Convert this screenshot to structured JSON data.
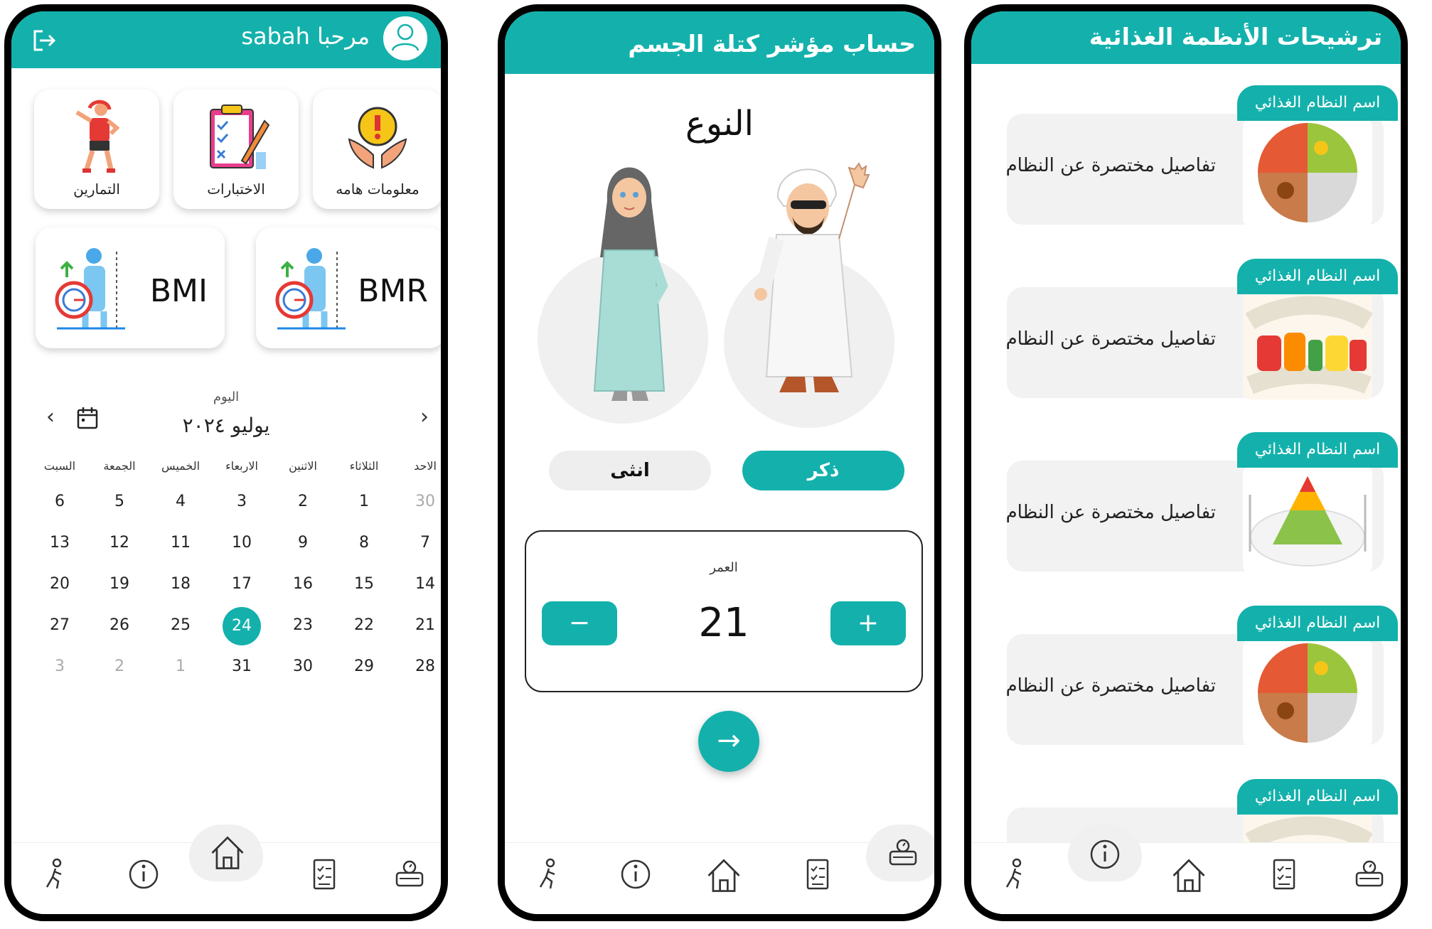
{
  "screen1": {
    "greeting": "مرحبا",
    "user_name": "sabah",
    "cards": [
      {
        "label": "معلومات هامه",
        "icon": "warning-hands-icon"
      },
      {
        "label": "الاختبارات",
        "icon": "checklist-icon"
      },
      {
        "label": "التمارين",
        "icon": "exercise-icon"
      }
    ],
    "bmi_cards": [
      "BMR",
      "BMI"
    ],
    "calendar": {
      "today_label": "اليوم",
      "month_label": "يوليو ٢٠٢٤",
      "weekdays": [
        "الاحد",
        "الثلاثاء",
        "الاثنين",
        "الاربعاء",
        "الخميس",
        "الجمعة",
        "السبت"
      ],
      "weeks": [
        [
          "30",
          "1",
          "2",
          "3",
          "4",
          "5",
          "6"
        ],
        [
          "7",
          "8",
          "9",
          "10",
          "11",
          "12",
          "13"
        ],
        [
          "14",
          "15",
          "16",
          "17",
          "18",
          "19",
          "20"
        ],
        [
          "21",
          "22",
          "23",
          "24",
          "25",
          "26",
          "27"
        ],
        [
          "28",
          "29",
          "30",
          "31",
          "1",
          "2",
          "3"
        ]
      ],
      "selected_day": "24"
    }
  },
  "screen2": {
    "title": "حساب مؤشر كتلة الجسم",
    "gender_title": "النوع",
    "male_label": "ذكر",
    "female_label": "انثى",
    "age_label": "العمر",
    "age_value": "21",
    "minus_label": "−",
    "plus_label": "+",
    "next_arrow": "→"
  },
  "screen3": {
    "title": "ترشيحات الأنظمة الغذائية",
    "diet_tab": "اسم النظام الغذائي",
    "diet_desc": "تفاصيل مختصرة عن النظام",
    "diets": [
      {
        "image": "food-plate-image"
      },
      {
        "image": "diet-tape-image"
      },
      {
        "image": "food-pyramid-image"
      },
      {
        "image": "food-plate-image"
      },
      {
        "image": "diet-tape-image"
      }
    ]
  },
  "colors": {
    "accent": "#14b1ac",
    "card_bg": "#f2f2f2",
    "nav_bump": "#f0f0f0"
  },
  "nav_icons": [
    "exercise-icon",
    "info-icon",
    "home-icon",
    "test-report-icon",
    "scale-icon"
  ]
}
